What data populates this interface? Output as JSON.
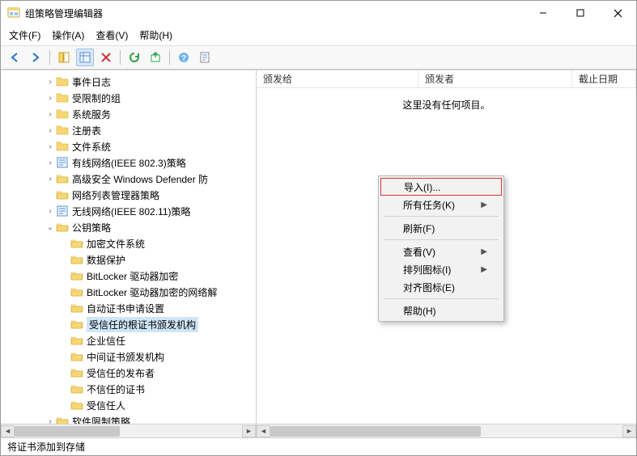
{
  "window": {
    "title": "组策略管理编辑器"
  },
  "menu": {
    "file": "文件(F)",
    "action": "操作(A)",
    "view": "查看(V)",
    "help": "帮助(H)"
  },
  "tree": [
    {
      "indent": 3,
      "expander": ">",
      "icon": "folder",
      "label": "事件日志"
    },
    {
      "indent": 3,
      "expander": ">",
      "icon": "folder",
      "label": "受限制的组"
    },
    {
      "indent": 3,
      "expander": ">",
      "icon": "folder",
      "label": "系统服务"
    },
    {
      "indent": 3,
      "expander": ">",
      "icon": "folder",
      "label": "注册表"
    },
    {
      "indent": 3,
      "expander": ">",
      "icon": "folder",
      "label": "文件系统"
    },
    {
      "indent": 3,
      "expander": ">",
      "icon": "policy",
      "label": "有线网络(IEEE 802.3)策略"
    },
    {
      "indent": 3,
      "expander": ">",
      "icon": "folder-open",
      "label": "高级安全 Windows Defender 防"
    },
    {
      "indent": 3,
      "expander": "",
      "icon": "folder-open",
      "label": "网络列表管理器策略"
    },
    {
      "indent": 3,
      "expander": ">",
      "icon": "policy",
      "label": "无线网络(IEEE 802.11)策略"
    },
    {
      "indent": 3,
      "expander": "v",
      "icon": "folder-open",
      "label": "公钥策略"
    },
    {
      "indent": 4,
      "expander": "",
      "icon": "folder-open",
      "label": "加密文件系统"
    },
    {
      "indent": 4,
      "expander": "",
      "icon": "folder-open",
      "label": "数据保护"
    },
    {
      "indent": 4,
      "expander": "",
      "icon": "folder-open",
      "label": "BitLocker 驱动器加密"
    },
    {
      "indent": 4,
      "expander": "",
      "icon": "folder-open",
      "label": "BitLocker 驱动器加密的网络解"
    },
    {
      "indent": 4,
      "expander": "",
      "icon": "folder-open",
      "label": "自动证书申请设置"
    },
    {
      "indent": 4,
      "expander": "",
      "icon": "folder-open",
      "label": "受信任的根证书颁发机构",
      "selected": true
    },
    {
      "indent": 4,
      "expander": "",
      "icon": "folder-open",
      "label": "企业信任"
    },
    {
      "indent": 4,
      "expander": "",
      "icon": "folder-open",
      "label": "中间证书颁发机构"
    },
    {
      "indent": 4,
      "expander": "",
      "icon": "folder-open",
      "label": "受信任的发布者"
    },
    {
      "indent": 4,
      "expander": "",
      "icon": "folder-open",
      "label": "不信任的证书"
    },
    {
      "indent": 4,
      "expander": "",
      "icon": "folder-open",
      "label": "受信任人"
    },
    {
      "indent": 3,
      "expander": ">",
      "icon": "folder-open",
      "label": "软件限制策略"
    }
  ],
  "list": {
    "columns": {
      "c1": "颁发给",
      "c2": "颁发者",
      "c3": "截止日期"
    },
    "empty": "这里没有任何项目。"
  },
  "context_menu": {
    "import": "导入(I)...",
    "all_tasks": "所有任务(K)",
    "refresh": "刷新(F)",
    "view": "查看(V)",
    "arrange": "排列图标(I)",
    "align": "对齐图标(E)",
    "help": "帮助(H)"
  },
  "status": "将证书添加到存储"
}
